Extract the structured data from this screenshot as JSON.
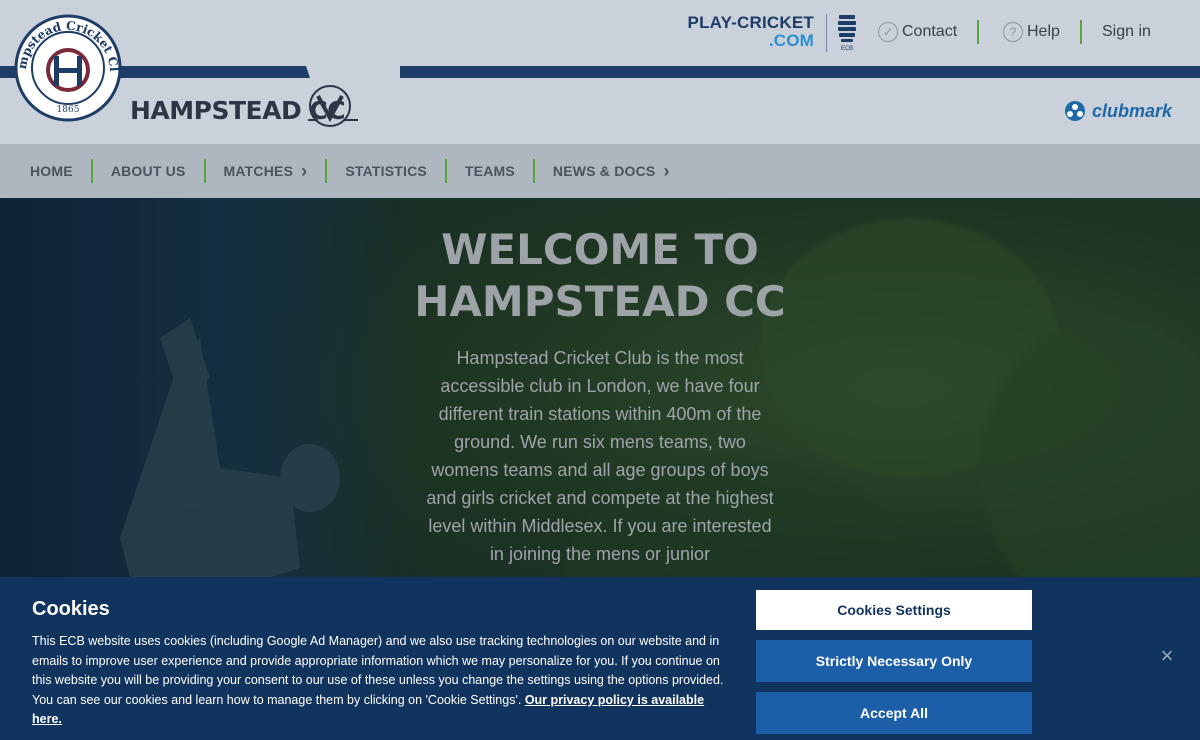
{
  "topbar": {
    "playcricket_line1": "PLAY-CRICKET",
    "playcricket_line2": ".COM",
    "ecb_label": "ECB",
    "contact_label": "Contact",
    "help_label": "Help",
    "signin_label": "Sign in"
  },
  "club": {
    "crest_text": "Hampstead Cricket Club",
    "crest_year": "1865",
    "name": "HAMPSTEAD CC",
    "clubmark_label": "clubmark"
  },
  "nav": {
    "items": [
      {
        "label": "HOME"
      },
      {
        "label": "ABOUT US"
      },
      {
        "label": "MATCHES"
      },
      {
        "label": "STATISTICS"
      },
      {
        "label": "TEAMS"
      },
      {
        "label": "NEWS & DOCS"
      }
    ]
  },
  "hero": {
    "title_line1": "WELCOME TO",
    "title_line2": "HAMPSTEAD CC",
    "body": "Hampstead Cricket Club is the most accessible club in London, we have four different train stations within 400m of the ground. We run six mens teams, two womens teams and all age groups of boys and girls cricket and compete at the highest level within Middlesex. If you are interested in joining the mens or junior"
  },
  "cookies": {
    "title": "Cookies",
    "body": "This ECB website uses cookies (including Google Ad Manager) and we also use tracking technologies on our website and in emails to improve user experience and provide appropriate information which we may personalize for you. If you continue on this website you will be providing your consent to our use of these unless you change the settings using the options provided. You can see our cookies and learn how to manage them by clicking on 'Cookie Settings'.",
    "privacy_link": "Our privacy policy is available here.",
    "settings_button": "Cookies Settings",
    "strict_button": "Strictly Necessary Only",
    "accept_button": "Accept All",
    "close_symbol": "×"
  },
  "colors": {
    "navy": "#1d3c66",
    "accent_green": "#5aa43f",
    "cookie_bg": "#11345f",
    "button_blue": "#1d5ea8"
  }
}
